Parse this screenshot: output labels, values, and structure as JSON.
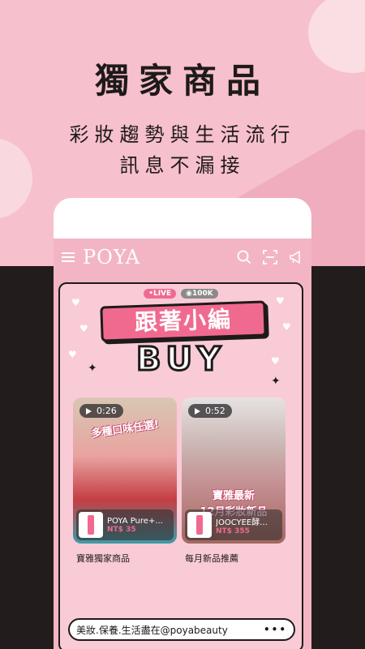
{
  "headline": "獨家商品",
  "sub_line1": "彩妝趨勢與生活流行",
  "sub_line2": "訊息不漏接",
  "app": {
    "logo": "POYA",
    "icons": [
      "menu-icon",
      "search-icon",
      "scan-icon",
      "megaphone-icon"
    ]
  },
  "banner": {
    "live_badge": "•LIVE",
    "views_badge": "◉100K",
    "title": "跟著小編",
    "buy": "BUY"
  },
  "videos": [
    {
      "duration": "0:26",
      "caption": "多種口味任選!",
      "product_name": "POYA Pure+...",
      "product_price": "NT$ 35",
      "label": "寶雅獨家商品"
    },
    {
      "duration": "0:52",
      "caption_line1": "寶雅最新",
      "caption_line2": "12月彩妝新品",
      "product_name": "JOOCYEE酵...",
      "product_price": "NT$ 355",
      "label": "每月新品推薦"
    }
  ],
  "footer": {
    "text": "美妝.保養.生活盡在@poyabeauty",
    "more": "•••"
  },
  "colors": {
    "pink_bg": "#f6c0cc",
    "accent": "#f06a90",
    "dark": "#231c1d"
  }
}
